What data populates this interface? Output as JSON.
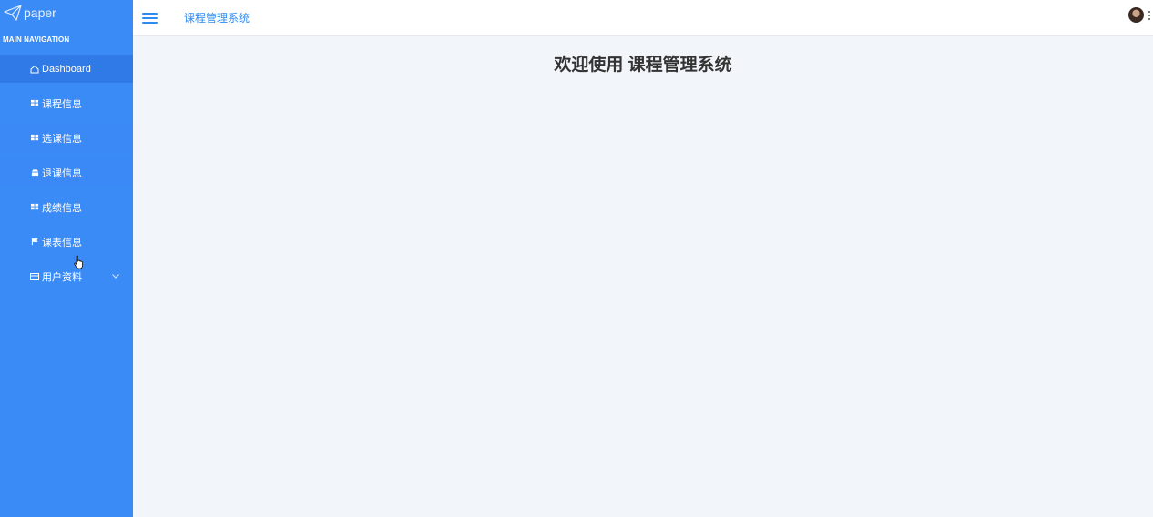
{
  "sidebar": {
    "logo_text": "paper",
    "section_title": "MAIN NAVIGATION",
    "items": [
      {
        "label": "Dashboard",
        "icon": "home-icon"
      },
      {
        "label": "课程信息",
        "icon": "grid-icon"
      },
      {
        "label": "选课信息",
        "icon": "grid-icon"
      },
      {
        "label": "退课信息",
        "icon": "shop-icon"
      },
      {
        "label": "成绩信息",
        "icon": "grid-icon"
      },
      {
        "label": "课表信息",
        "icon": "flag-icon"
      },
      {
        "label": "用户资料",
        "icon": "card-icon"
      }
    ]
  },
  "header": {
    "app_title": "课程管理系统"
  },
  "main": {
    "welcome": "欢迎使用 课程管理系统"
  },
  "colors": {
    "sidebar_bg": "#3b8bf7",
    "accent": "#2e8cf0",
    "main_bg": "#f2f5f9"
  }
}
